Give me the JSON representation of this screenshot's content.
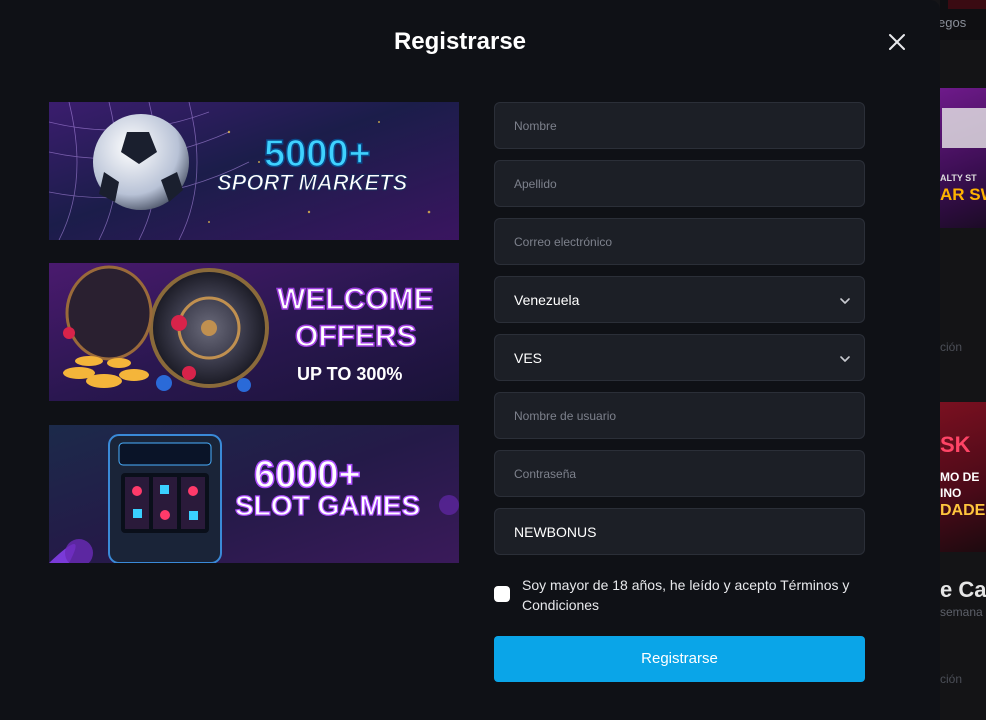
{
  "background": {
    "nav_text": "egos",
    "banner1_line1": "ALTY ST",
    "banner1_line2": "AR SW",
    "caption1": "ción",
    "banner2_line1": "SK",
    "banner2_line2": "MO DE",
    "banner2_line3": "INO",
    "banner2_line4": "DADE",
    "caption2": "e Ca",
    "caption3": "semana",
    "caption4": "ción"
  },
  "modal": {
    "title": "Registrarse",
    "close_icon": "close-icon"
  },
  "promos": [
    {
      "line1": "5000+",
      "line2": "SPORT MARKETS"
    },
    {
      "line1": "WELCOME",
      "line2": "OFFERS",
      "line3": "UP TO 300%"
    },
    {
      "line1": "6000+",
      "line2": "SLOT GAMES"
    }
  ],
  "form": {
    "first_name_placeholder": "Nombre",
    "last_name_placeholder": "Apellido",
    "email_placeholder": "Correo electrónico",
    "country_value": "Venezuela",
    "currency_value": "VES",
    "username_placeholder": "Nombre de usuario",
    "password_placeholder": "Contraseña",
    "promo_code_value": "NEWBONUS",
    "terms_text": "Soy mayor de 18 años, he leído y acepto Términos y Condiciones",
    "submit_label": "Registrarse"
  },
  "colors": {
    "modal_bg": "#0f1116",
    "field_bg": "#1c1f26",
    "accent": "#0aa5e8"
  }
}
